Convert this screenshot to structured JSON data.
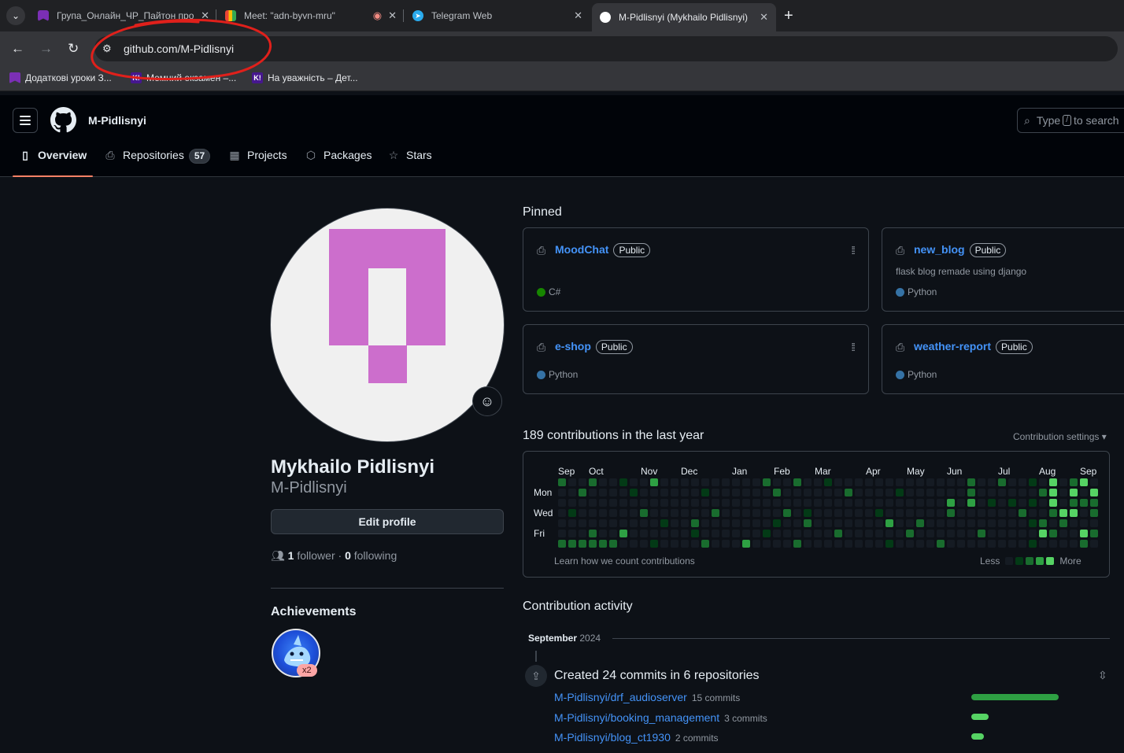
{
  "browser": {
    "tabs": [
      {
        "title": "Група_Онлайн_ЧР_Пайтон про",
        "favicon_color": "#7b2fb5"
      },
      {
        "title": "Meet: \"adn-byvn-mru\"",
        "favicon_color": "#34a853"
      },
      {
        "title": "Telegram Web",
        "favicon_color": "#2aabee"
      },
      {
        "title": "M-Pidlisnyi (Mykhailo Pidlisnyi)",
        "favicon_color": "#ffffff"
      }
    ],
    "url": "github.com/M-Pidlisnyi",
    "bookmarks": [
      {
        "label": "Додаткові уроки З...",
        "icon": "purple-square"
      },
      {
        "label": "Мемний екзамен –...",
        "icon": "K!"
      },
      {
        "label": "На уважність – Дет...",
        "icon": "K!"
      }
    ]
  },
  "header": {
    "username": "M-Pidlisnyi",
    "search_pre": "Type",
    "search_key": "/",
    "search_post": "to search"
  },
  "nav": {
    "overview": "Overview",
    "repositories": "Repositories",
    "repo_count": "57",
    "projects": "Projects",
    "packages": "Packages",
    "stars": "Stars"
  },
  "profile": {
    "full_name": "Mykhailo Pidlisnyi",
    "login": "M-Pidlisnyi",
    "edit_label": "Edit profile",
    "followers": "1",
    "followers_label": "follower",
    "following": "0",
    "following_label": "following",
    "achievements_title": "Achievements",
    "achievement_count": "x2"
  },
  "pinned": {
    "title": "Pinned",
    "repos": [
      {
        "name": "MoodChat",
        "visibility": "Public",
        "description": "",
        "language": "C#",
        "lang_color": "#178600"
      },
      {
        "name": "new_blog",
        "visibility": "Public",
        "description": "flask blog remade using django",
        "language": "Python",
        "lang_color": "#3572A5"
      },
      {
        "name": "e-shop",
        "visibility": "Public",
        "description": "",
        "language": "Python",
        "lang_color": "#3572A5"
      },
      {
        "name": "weather-report",
        "visibility": "Public",
        "description": "",
        "language": "Python",
        "lang_color": "#3572A5"
      }
    ]
  },
  "contributions": {
    "title": "189 contributions in the last year",
    "settings": "Contribution settings",
    "months": [
      "Sep",
      "Oct",
      "Nov",
      "Dec",
      "Jan",
      "Feb",
      "Mar",
      "Apr",
      "May",
      "Jun",
      "Jul",
      "Aug",
      "Sep"
    ],
    "days": [
      "Mon",
      "Wed",
      "Fri"
    ],
    "learn": "Learn how we count contributions",
    "less": "Less",
    "more": "More",
    "level_colors": [
      "#151b23",
      "#033a16",
      "#196c2e",
      "#2ea043",
      "#56d364"
    ]
  },
  "activity": {
    "title": "Contribution activity",
    "month": "September",
    "year": "2024",
    "created": "Created 24 commits in 6 repositories",
    "rows": [
      {
        "repo": "M-Pidlisnyi/drf_audioserver",
        "commits": "15 commits",
        "share": 15
      },
      {
        "repo": "M-Pidlisnyi/booking_management",
        "commits": "3 commits",
        "share": 3
      },
      {
        "repo": "M-Pidlisnyi/blog_ct1930",
        "commits": "2 commits",
        "share": 2
      }
    ]
  }
}
